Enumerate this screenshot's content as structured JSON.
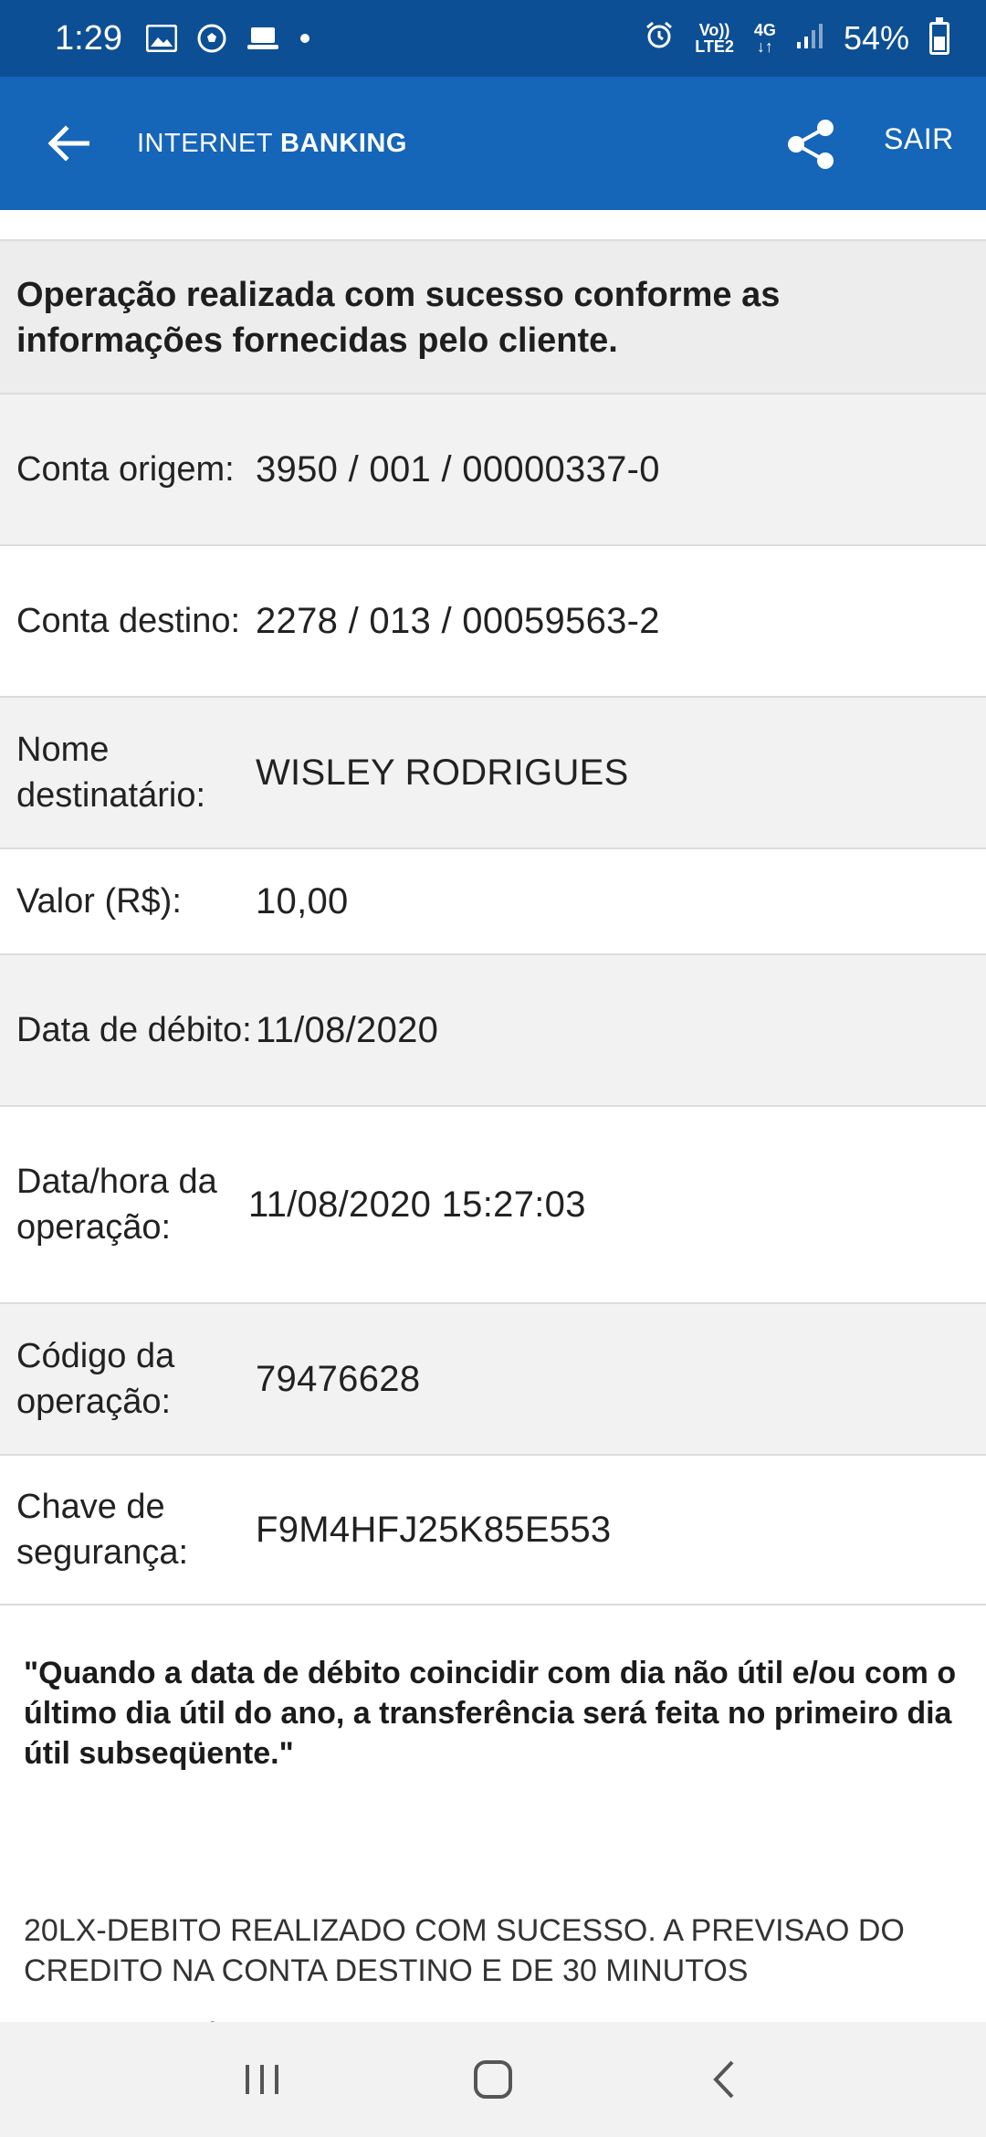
{
  "status_bar": {
    "time": "1:29",
    "battery": "54%",
    "network_top": "Vo))",
    "network_bottom": "LTE2",
    "network_type": "4G",
    "left_icons": [
      "gallery-icon",
      "soccer-ball-icon",
      "laptop-icon",
      "dot-icon"
    ],
    "right_icons": [
      "alarm-icon",
      "signal-icon",
      "battery-icon"
    ]
  },
  "app_bar": {
    "title_light": "INTERNET",
    "title_bold": "BANKING",
    "logout_label": "SAIR",
    "background": "#1565b8",
    "status_background": "#0d4f94"
  },
  "success_message": "Operação realizada com sucesso conforme as informações fornecidas pelo cliente.",
  "details": [
    {
      "label": "Conta origem:",
      "value": "3950 / 001 / 00000337-0"
    },
    {
      "label": "Conta destino:",
      "value": "2278 / 013 / 00059563-2"
    },
    {
      "label": "Nome destinatário:",
      "value": "WISLEY RODRIGUES"
    },
    {
      "label": "Valor (R$):",
      "value": "10,00"
    },
    {
      "label": "Data de débito:",
      "value": "11/08/2020"
    },
    {
      "label": "Data/hora da operação:",
      "value": "11/08/2020 15:27:03"
    },
    {
      "label": "Código da operação:",
      "value": "79476628"
    },
    {
      "label": "Chave de segurança:",
      "value": "F9M4HFJ25K85E553"
    }
  ],
  "notice": "\"Quando a data de débito coincidir com dia não útil e/ou com o último dia útil do ano, a transferência será feita no primeiro dia útil subseqüente.\"",
  "info": "20LX-DEBITO REALIZADO COM SUCESSO. A PREVISAO DO CREDITO NA CONTA DESTINO E DE 30 MINUTOS",
  "info_cut": "* Você poderá consultar os seus comprovantes de operações na opção",
  "nav_bar": {
    "icons": [
      "recent-apps-icon",
      "home-icon",
      "back-nav-icon"
    ]
  }
}
